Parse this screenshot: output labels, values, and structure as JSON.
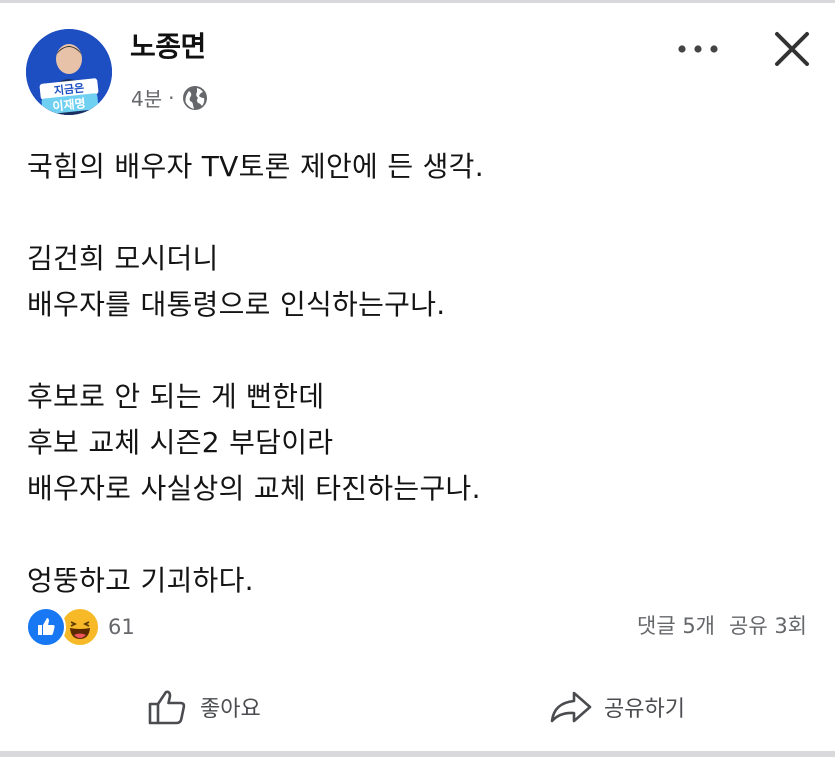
{
  "post": {
    "author": "노종면",
    "time": "4분",
    "separator": "·",
    "privacy_icon": "globe-icon",
    "avatar_banner_line1": "지금은",
    "avatar_banner_line2": "이재명",
    "paragraphs": [
      [
        "국힘의 배우자 TV토론 제안에 든 생각."
      ],
      [
        "김건희 모시더니",
        "배우자를 대통령으로 인식하는구나."
      ],
      [
        "후보로 안 되는 게 뻔한데",
        "후보 교체 시즌2 부담이라",
        "배우자로 사실상의 교체 타진하는구나."
      ],
      [
        "엉뚱하고 기괴하다."
      ]
    ]
  },
  "reactions": {
    "icons": [
      "like-reaction-icon",
      "haha-reaction-icon"
    ],
    "count": "61"
  },
  "stats": {
    "comments": "댓글 5개",
    "shares": "공유 3회"
  },
  "actions": {
    "like_label": "좋아요",
    "share_label": "공유하기"
  },
  "colors": {
    "like_blue": "#1877f2",
    "haha_yellow": "#f7b928",
    "avatar_blue": "#1d4fc2",
    "meta_gray": "#65676b"
  }
}
